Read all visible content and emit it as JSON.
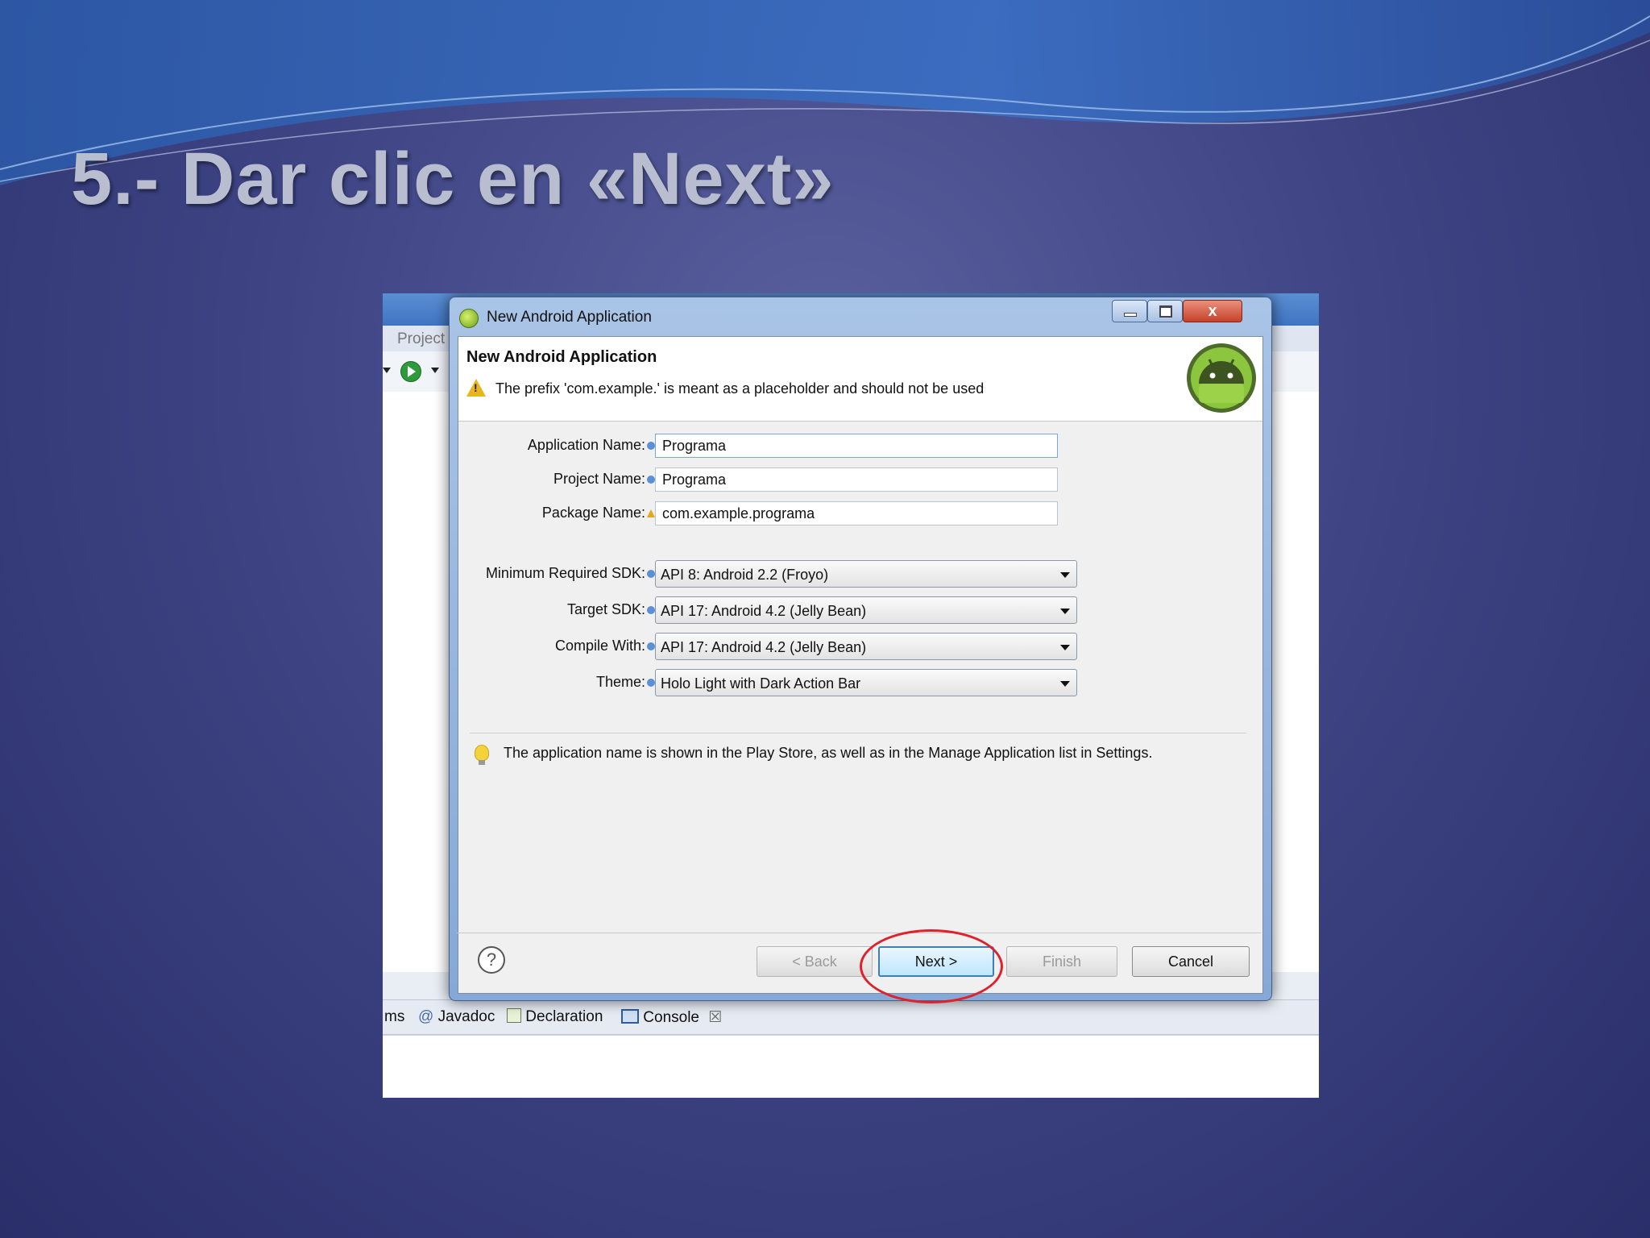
{
  "slide": {
    "title": "5.- Dar clic en  «Next»"
  },
  "eclipse": {
    "tab_label": "Project",
    "bottom_tabs": [
      {
        "label": "ms",
        "icon": ""
      },
      {
        "label": "Javadoc",
        "icon": "at-icon"
      },
      {
        "label": "Declaration",
        "icon": "declaration-icon"
      },
      {
        "label": "Console",
        "icon": "console-icon",
        "close": "☒"
      }
    ]
  },
  "dialog": {
    "window_title": "New Android Application",
    "close_glyph": "x",
    "header": {
      "title": "New Android Application",
      "message": "The prefix 'com.example.' is meant as a placeholder and should not be used"
    },
    "fields": {
      "application_name": {
        "label": "Application Name:",
        "value": "Programa"
      },
      "project_name": {
        "label": "Project Name:",
        "value": "Programa"
      },
      "package_name": {
        "label": "Package Name:",
        "value": "com.example.programa"
      }
    },
    "selects": {
      "min_sdk": {
        "label": "Minimum Required SDK:",
        "value": "API 8: Android 2.2 (Froyo)"
      },
      "target_sdk": {
        "label": "Target SDK:",
        "value": "API 17: Android 4.2 (Jelly Bean)"
      },
      "compile_with": {
        "label": "Compile With:",
        "value": "API 17: Android 4.2 (Jelly Bean)"
      },
      "theme": {
        "label": "Theme:",
        "value": "Holo Light with Dark Action Bar"
      }
    },
    "tip": "The application name is shown in the Play Store, as well as in the Manage Application list in Settings.",
    "help_glyph": "?",
    "buttons": {
      "back": "< Back",
      "next": "Next >",
      "finish": "Finish",
      "cancel": "Cancel"
    },
    "colors": {
      "highlight_circle": "#e0202a",
      "android_green": "#8cc63f"
    }
  }
}
